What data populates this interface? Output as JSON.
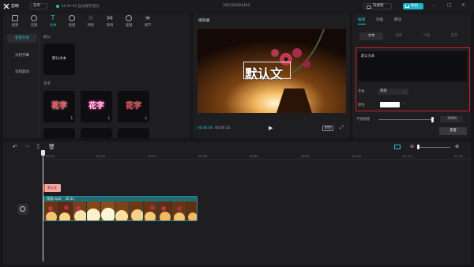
{
  "app": {
    "name": "剪映",
    "menu_label": "菜单",
    "save_status": "14:05:20 自动保存成功",
    "doc_title": "202103091402",
    "shortcut_label": "快捷键",
    "export_label": "导出"
  },
  "media_tabs": [
    {
      "label": "视频",
      "icon": "video-icon"
    },
    {
      "label": "音频",
      "icon": "audio-icon"
    },
    {
      "label": "文本",
      "icon": "text-icon"
    },
    {
      "label": "贴纸",
      "icon": "sticker-icon"
    },
    {
      "label": "特效",
      "icon": "effects-icon"
    },
    {
      "label": "转场",
      "icon": "transition-icon"
    },
    {
      "label": "滤镜",
      "icon": "filter-icon"
    },
    {
      "label": "调节",
      "icon": "adjust-icon"
    }
  ],
  "text_sidebar": [
    {
      "label": "新建文本"
    },
    {
      "label": "识别字幕"
    },
    {
      "label": "识别歌词"
    }
  ],
  "text_library": {
    "default_section": "默认",
    "default_card": "默认文本",
    "fancy_section": "花字",
    "fancy_cards": [
      {
        "text": "花字",
        "color": "#ff3b4a"
      },
      {
        "text": "花字",
        "color": "#ff6fb1"
      },
      {
        "text": "花字",
        "color": "#e8323f"
      }
    ]
  },
  "player": {
    "label": "播放器",
    "overlay_text": "默认文",
    "time_current": "00:00:00",
    "time_total": "00:00:31",
    "ratio_label": "原始"
  },
  "properties": {
    "tabs": [
      "编辑",
      "动画",
      "朗读"
    ],
    "subtabs": [
      "文本",
      "排列",
      "气泡",
      "花字"
    ],
    "text_value": "默认文本",
    "font_label": "字体",
    "font_value": "系统",
    "color_label": "颜色",
    "color_value": "#ffffff",
    "opacity_label": "不透明度",
    "opacity_value": "100%",
    "opacity_fraction": 1.0,
    "reset_label": "重置"
  },
  "timeline": {
    "ticks": [
      "00:00",
      "00:10",
      "00:20",
      "00:30",
      "00:40",
      "00:50",
      "01:00",
      "01:10",
      "01:20"
    ],
    "text_clip_label": "默认文",
    "video_clip_name": "视频.mp4",
    "video_clip_duration": "30.1s"
  },
  "colors": {
    "accent": "#1fb4c6",
    "highlight_border": "#d21d28"
  }
}
